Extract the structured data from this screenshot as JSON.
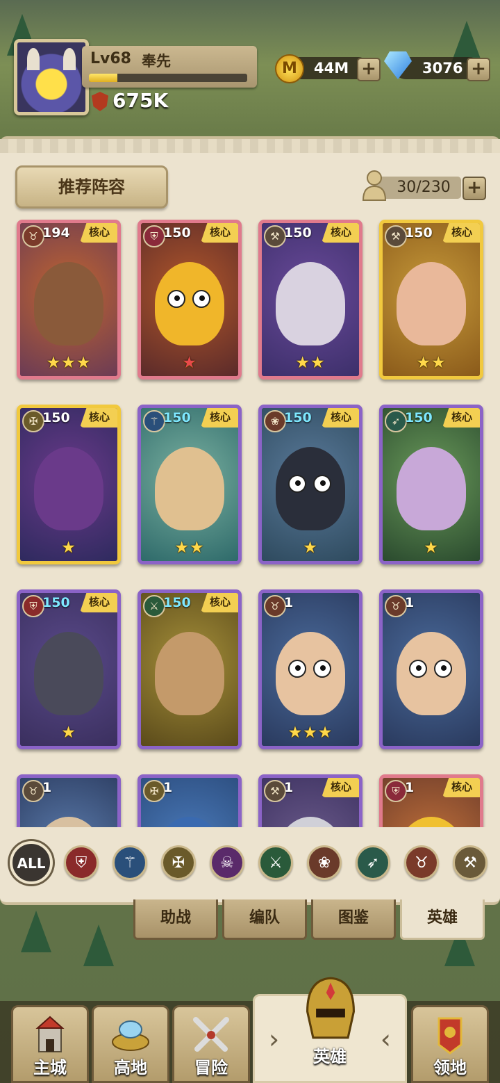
{
  "player": {
    "level": "Lv68",
    "name": "奉先",
    "xp_fraction": 0.18,
    "power": "675K"
  },
  "resources": {
    "gold": "44M",
    "gems": "3076",
    "plus": "+"
  },
  "panel": {
    "recommend_label": "推荐阵容",
    "capacity": "30/230",
    "plus": "+"
  },
  "cards": [
    {
      "level": "194",
      "level_color": "white",
      "core": "核心",
      "stars": "★★★",
      "star_color": "gold",
      "frame": "red"
    },
    {
      "level": "150",
      "level_color": "white",
      "core": "核心",
      "stars": "★",
      "star_color": "red",
      "frame": "red"
    },
    {
      "level": "150",
      "level_color": "white",
      "core": "核心",
      "stars": "★★",
      "star_color": "gold",
      "frame": "red"
    },
    {
      "level": "150",
      "level_color": "white",
      "core": "核心",
      "stars": "★★",
      "star_color": "gold",
      "frame": "gold"
    },
    {
      "level": "150",
      "level_color": "white",
      "core": "核心",
      "stars": "★",
      "star_color": "gold",
      "frame": "gold"
    },
    {
      "level": "150",
      "level_color": "cyan",
      "core": "核心",
      "stars": "★★",
      "star_color": "gold",
      "frame": "purple"
    },
    {
      "level": "150",
      "level_color": "cyan",
      "core": "核心",
      "stars": "★",
      "star_color": "gold",
      "frame": "purple"
    },
    {
      "level": "150",
      "level_color": "cyan",
      "core": "核心",
      "stars": "★",
      "star_color": "gold",
      "frame": "purple"
    },
    {
      "level": "150",
      "level_color": "cyan",
      "core": "核心",
      "stars": "★",
      "star_color": "gold",
      "frame": "purple"
    },
    {
      "level": "150",
      "level_color": "cyan",
      "core": "核心",
      "stars": "",
      "star_color": "gold",
      "frame": "purple"
    },
    {
      "level": "1",
      "level_color": "white",
      "core": "",
      "stars": "★★★",
      "star_color": "gold",
      "frame": "purple"
    },
    {
      "level": "1",
      "level_color": "white",
      "core": "",
      "stars": "",
      "star_color": "gold",
      "frame": "purple"
    },
    {
      "level": "1",
      "level_color": "white",
      "core": "",
      "stars": "",
      "star_color": "gold",
      "frame": "purple"
    },
    {
      "level": "1",
      "level_color": "white",
      "core": "",
      "stars": "",
      "star_color": "gold",
      "frame": "purple"
    },
    {
      "level": "1",
      "level_color": "white",
      "core": "核心",
      "stars": "",
      "star_color": "gold",
      "frame": "purple"
    },
    {
      "level": "1",
      "level_color": "white",
      "core": "核心",
      "stars": "",
      "star_color": "gold",
      "frame": "red"
    }
  ],
  "filters": {
    "all_label": "ALL",
    "classes": [
      "shield-icon",
      "staff-icon",
      "holy-icon",
      "skull-icon",
      "daggers-icon",
      "paw-icon",
      "bow-icon",
      "bull-icon",
      "hammer-icon"
    ]
  },
  "sub_tabs": [
    "助战",
    "编队",
    "图鉴",
    "英雄"
  ],
  "nav": [
    "主城",
    "高地",
    "冒险",
    "英雄",
    "领地"
  ]
}
